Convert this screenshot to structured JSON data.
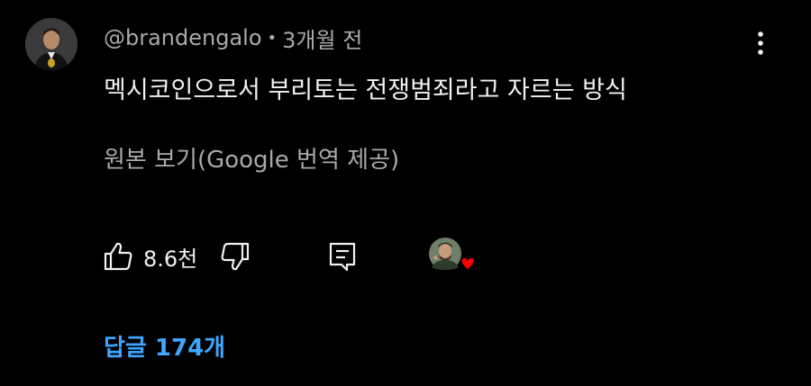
{
  "comment": {
    "author": "@brandengalo",
    "separator": "•",
    "time": "3개월 전",
    "text": "멕시코인으로서 부리토는 전쟁범죄라고 자르는 방식",
    "translate_label": "원본 보기(Google 번역 제공)",
    "like_count": "8.6천",
    "replies_label": "답글 174개"
  },
  "icons": {
    "avatar": "author-avatar",
    "more": "more-vertical-icon",
    "like": "thumbs-up-icon",
    "dislike": "thumbs-down-icon",
    "reply": "reply-comment-icon",
    "creator_heart": "creator-heart-badge"
  },
  "colors": {
    "background": "#000000",
    "text_primary": "#f1f1f1",
    "text_secondary": "#aaaaaa",
    "link_blue": "#3ea6ff",
    "heart_red": "#ff0000"
  }
}
